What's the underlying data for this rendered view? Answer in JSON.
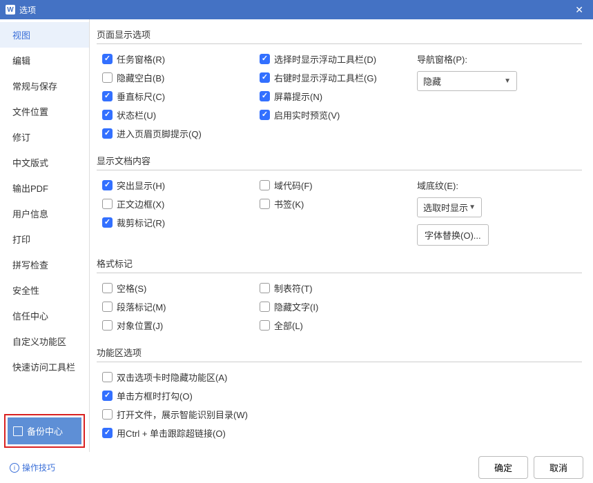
{
  "titlebar": {
    "title": "选项"
  },
  "sidebar": {
    "items": [
      "视图",
      "编辑",
      "常规与保存",
      "文件位置",
      "修订",
      "中文版式",
      "输出PDF",
      "用户信息",
      "打印",
      "拼写检查",
      "安全性",
      "信任中心",
      "自定义功能区",
      "快速访问工具栏"
    ],
    "backup": "备份中心"
  },
  "sections": {
    "pageDisplay": {
      "title": "页面显示选项",
      "col1": [
        "任务窗格(R)",
        "隐藏空白(B)",
        "垂直标尺(C)",
        "状态栏(U)",
        "进入页眉页脚提示(Q)"
      ],
      "col2": [
        "选择时显示浮动工具栏(D)",
        "右键时显示浮动工具栏(G)",
        "屏幕提示(N)",
        "启用实时预览(V)"
      ],
      "navLabel": "导航窗格(P):",
      "navValue": "隐藏"
    },
    "docContent": {
      "title": "显示文档内容",
      "col1": [
        "突出显示(H)",
        "正文边框(X)",
        "裁剪标记(R)"
      ],
      "col2": [
        "域代码(F)",
        "书签(K)"
      ],
      "shadingLabel": "域底纹(E):",
      "shadingValue": "选取时显示",
      "fontBtn": "字体替换(O)..."
    },
    "format": {
      "title": "格式标记",
      "col1": [
        "空格(S)",
        "段落标记(M)",
        "对象位置(J)"
      ],
      "col2": [
        "制表符(T)",
        "隐藏文字(I)",
        "全部(L)"
      ]
    },
    "func": {
      "title": "功能区选项",
      "items": [
        "双击选项卡时隐藏功能区(A)",
        "单击方框时打勾(O)",
        "打开文件，展示智能识别目录(W)",
        "用Ctrl + 单击跟踪超链接(O)"
      ]
    }
  },
  "checks": {
    "p1": [
      true,
      false,
      true,
      true,
      true
    ],
    "p2": [
      true,
      true,
      true,
      true
    ],
    "d1": [
      true,
      false,
      true
    ],
    "d2": [
      false,
      false
    ],
    "f1": [
      false,
      false,
      false
    ],
    "f2": [
      false,
      false,
      false
    ],
    "fn": [
      false,
      true,
      false,
      true
    ]
  },
  "footer": {
    "tips": "操作技巧",
    "ok": "确定",
    "cancel": "取消"
  }
}
